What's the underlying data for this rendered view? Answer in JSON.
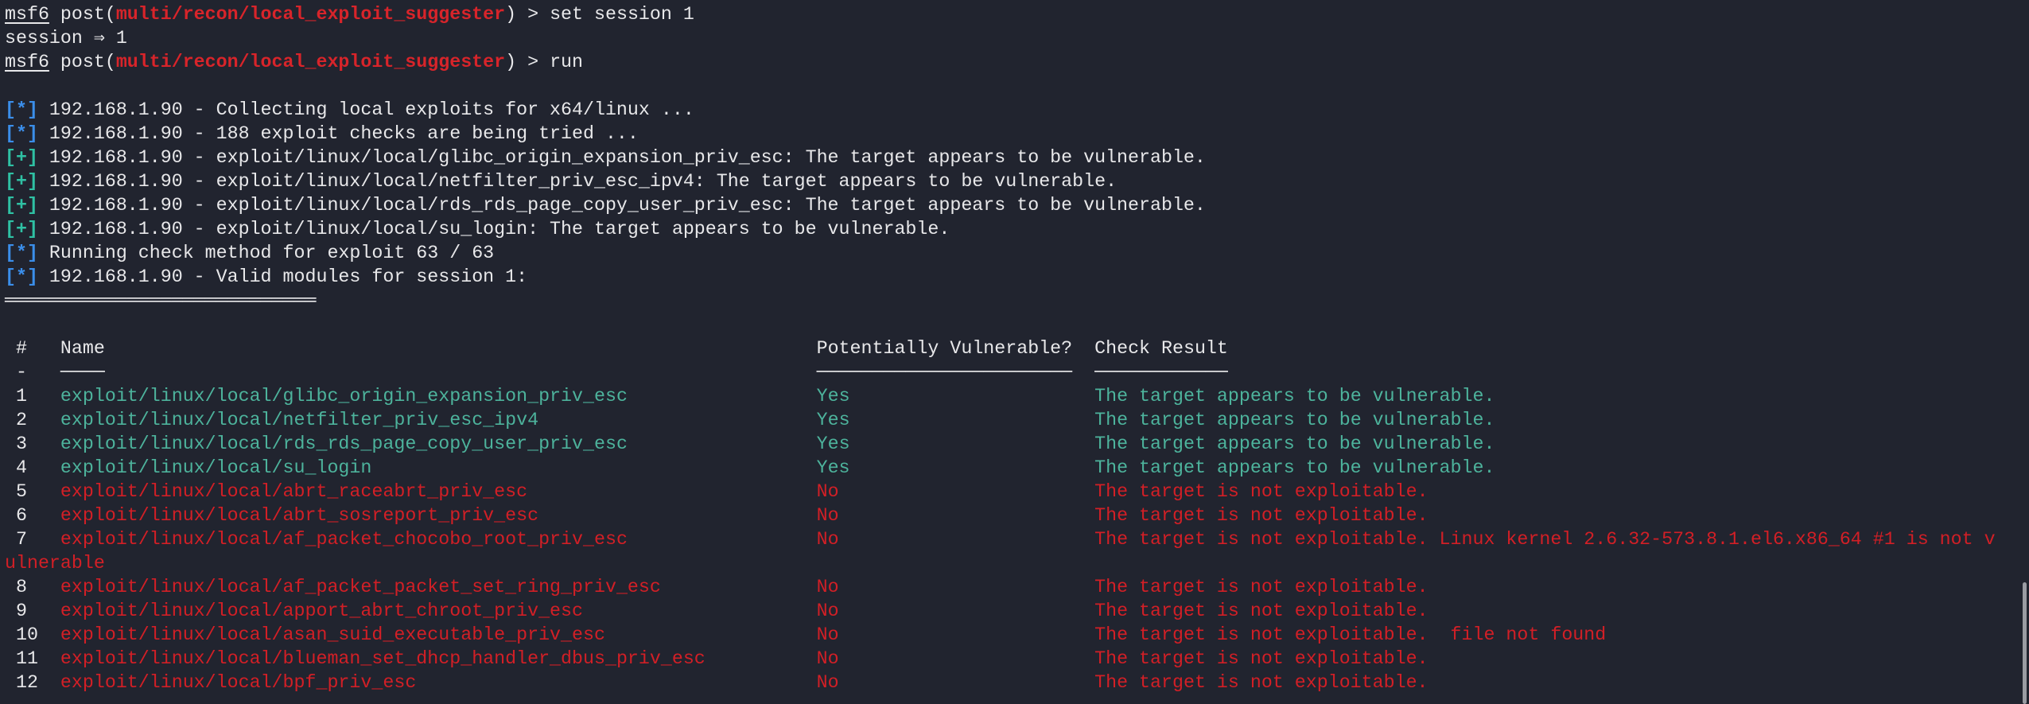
{
  "colors": {
    "background": "#21242f",
    "prompt_module": "#d8242a",
    "info_marker": "#3b8eea",
    "good_marker": "#2fc1a4",
    "vulnerable": "#4db39c",
    "not_vulnerable": "#d21f26"
  },
  "prompt": {
    "shell": "msf6",
    "type": "post",
    "module": "multi/recon/local_exploit_suggester",
    "arrow": " > "
  },
  "commands": [
    "set session 1",
    "run"
  ],
  "set_output": "session ⇒ 1",
  "log": [
    {
      "marker": "[*]",
      "kind": "info",
      "text": " 192.168.1.90 - Collecting local exploits for x64/linux ..."
    },
    {
      "marker": "[*]",
      "kind": "info",
      "text": " 192.168.1.90 - 188 exploit checks are being tried ..."
    },
    {
      "marker": "[+]",
      "kind": "good",
      "text": " 192.168.1.90 - exploit/linux/local/glibc_origin_expansion_priv_esc: The target appears to be vulnerable."
    },
    {
      "marker": "[+]",
      "kind": "good",
      "text": " 192.168.1.90 - exploit/linux/local/netfilter_priv_esc_ipv4: The target appears to be vulnerable."
    },
    {
      "marker": "[+]",
      "kind": "good",
      "text": " 192.168.1.90 - exploit/linux/local/rds_rds_page_copy_user_priv_esc: The target appears to be vulnerable."
    },
    {
      "marker": "[+]",
      "kind": "good",
      "text": " 192.168.1.90 - exploit/linux/local/su_login: The target appears to be vulnerable."
    },
    {
      "marker": "[*]",
      "kind": "info",
      "text": " Running check method for exploit 63 / 63"
    },
    {
      "marker": "[*]",
      "kind": "info",
      "text": " 192.168.1.90 - Valid modules for session 1:"
    }
  ],
  "title_rule": "════════════════════════════",
  "table": {
    "headers": [
      "#",
      "Name",
      "Potentially Vulnerable?",
      "Check Result"
    ],
    "rules": [
      "-",
      "────",
      "───────────────────────",
      "────────────"
    ],
    "rows": [
      {
        "num": "1",
        "name": "exploit/linux/local/glibc_origin_expansion_priv_esc",
        "vuln": "Yes",
        "result": "The target appears to be vulnerable."
      },
      {
        "num": "2",
        "name": "exploit/linux/local/netfilter_priv_esc_ipv4",
        "vuln": "Yes",
        "result": "The target appears to be vulnerable."
      },
      {
        "num": "3",
        "name": "exploit/linux/local/rds_rds_page_copy_user_priv_esc",
        "vuln": "Yes",
        "result": "The target appears to be vulnerable."
      },
      {
        "num": "4",
        "name": "exploit/linux/local/su_login",
        "vuln": "Yes",
        "result": "The target appears to be vulnerable."
      },
      {
        "num": "5",
        "name": "exploit/linux/local/abrt_raceabrt_priv_esc",
        "vuln": "No",
        "result": "The target is not exploitable."
      },
      {
        "num": "6",
        "name": "exploit/linux/local/abrt_sosreport_priv_esc",
        "vuln": "No",
        "result": "The target is not exploitable."
      },
      {
        "num": "7",
        "name": "exploit/linux/local/af_packet_chocobo_root_priv_esc",
        "vuln": "No",
        "result": "The target is not exploitable. Linux kernel 2.6.32-573.8.1.el6.x86_64 #1 is not vulnerable"
      },
      {
        "num": "8",
        "name": "exploit/linux/local/af_packet_packet_set_ring_priv_esc",
        "vuln": "No",
        "result": "The target is not exploitable."
      },
      {
        "num": "9",
        "name": "exploit/linux/local/apport_abrt_chroot_priv_esc",
        "vuln": "No",
        "result": "The target is not exploitable."
      },
      {
        "num": "10",
        "name": "exploit/linux/local/asan_suid_executable_priv_esc",
        "vuln": "No",
        "result": "The target is not exploitable.  file not found"
      },
      {
        "num": "11",
        "name": "exploit/linux/local/blueman_set_dhcp_handler_dbus_priv_esc",
        "vuln": "No",
        "result": "The target is not exploitable."
      },
      {
        "num": "12",
        "name": "exploit/linux/local/bpf_priv_esc",
        "vuln": "No",
        "result": "The target is not exploitable."
      }
    ]
  }
}
